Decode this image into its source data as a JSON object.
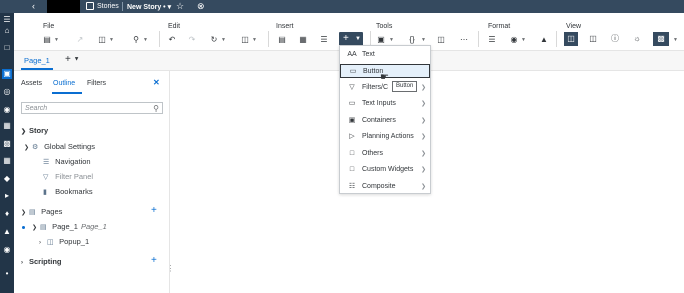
{
  "topbar": {
    "app": "Stories",
    "story_title": "New Story",
    "title_suffix": " • ▾"
  },
  "toolbar": {
    "groups": {
      "file": "File",
      "edit": "Edit",
      "insert": "Insert",
      "tools": "Tools",
      "format": "Format",
      "view": "View"
    },
    "insert_button": "+"
  },
  "pagetabs": {
    "active": "Page_1"
  },
  "panel": {
    "tabs": [
      "Assets",
      "Outline",
      "Filters"
    ],
    "active_tab": "Outline",
    "search_placeholder": "Search",
    "tree": {
      "story": "Story",
      "global_settings": "Global Settings",
      "navigation": "Navigation",
      "filter_panel": "Filter Panel",
      "bookmarks": "Bookmarks",
      "pages": "Pages",
      "page1": "Page_1",
      "page1_alias": "Page_1",
      "popup1": "Popup_1",
      "scripting": "Scripting"
    }
  },
  "insert_menu": {
    "items": [
      {
        "icon": "AA",
        "label": "Text",
        "submenu": false
      },
      {
        "icon": "▭",
        "label": "Button",
        "submenu": false
      },
      {
        "icon": "▽",
        "label": "Filters/C",
        "submenu": true
      },
      {
        "icon": "▭",
        "label": "Text Inputs",
        "submenu": true
      },
      {
        "icon": "▣",
        "label": "Containers",
        "submenu": true
      },
      {
        "icon": "▷",
        "label": "Planning Actions",
        "submenu": true
      },
      {
        "icon": "□",
        "label": "Others",
        "submenu": true
      },
      {
        "icon": "□",
        "label": "Custom Widgets",
        "submenu": true
      },
      {
        "icon": "☷",
        "label": "Composite",
        "submenu": true
      }
    ],
    "hovered": "Button",
    "tooltip": "Button"
  }
}
